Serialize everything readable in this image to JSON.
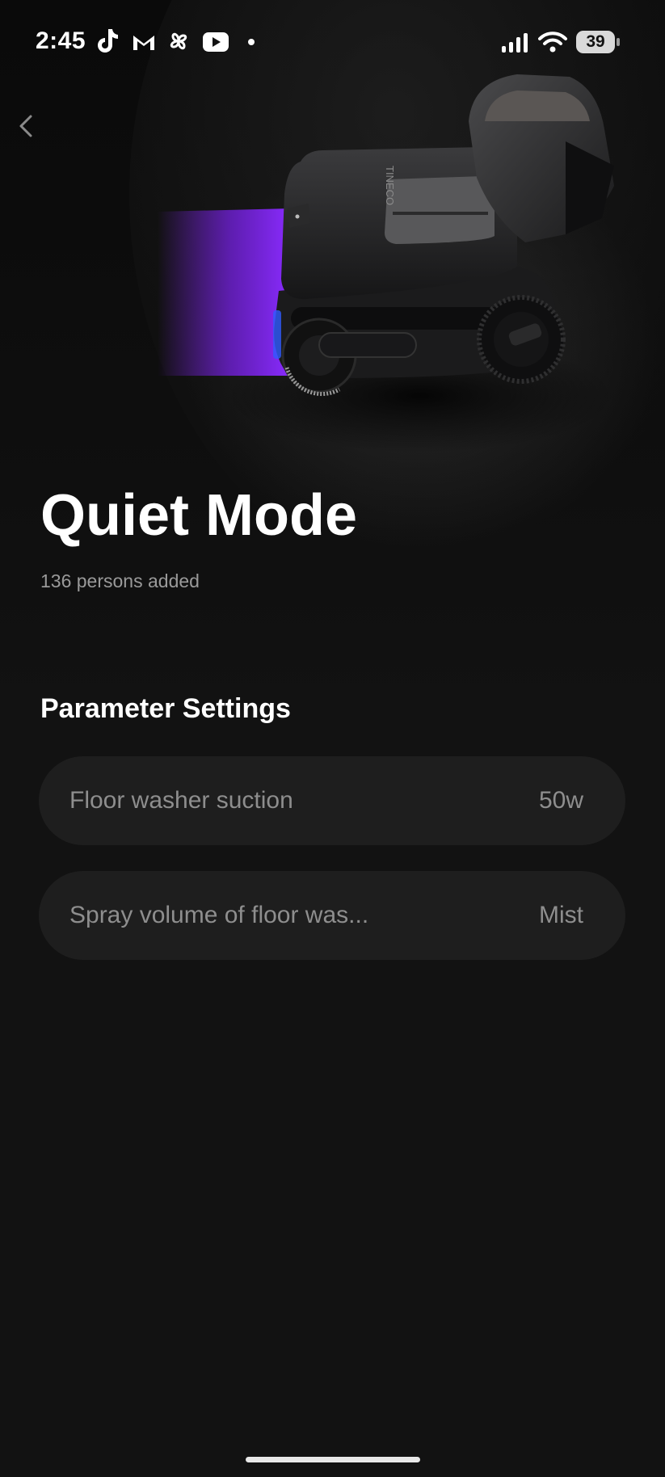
{
  "status_bar": {
    "time": "2:45",
    "notification_icons": [
      "tiktok-icon",
      "gmail-icon",
      "pinwheel-icon",
      "youtube-icon",
      "dot-icon"
    ],
    "signal_icon": "cellular-signal-icon",
    "wifi_icon": "wifi-icon",
    "battery_level": "39"
  },
  "header": {
    "back_icon": "chevron-left-icon",
    "hero_image": "floor-washer-device-image"
  },
  "mode": {
    "title": "Quiet Mode",
    "subtitle": "136 persons added"
  },
  "parameters": {
    "section_title": "Parameter Settings",
    "items": [
      {
        "label": "Floor washer suction",
        "value": "50w"
      },
      {
        "label": "Spray volume of floor was...",
        "value": "Mist"
      }
    ]
  },
  "colors": {
    "background": "#121212",
    "row_background": "#1e1e1e",
    "accent_purple": "#7a22e0",
    "text_primary": "#ffffff",
    "text_secondary": "#9a9a9a"
  }
}
